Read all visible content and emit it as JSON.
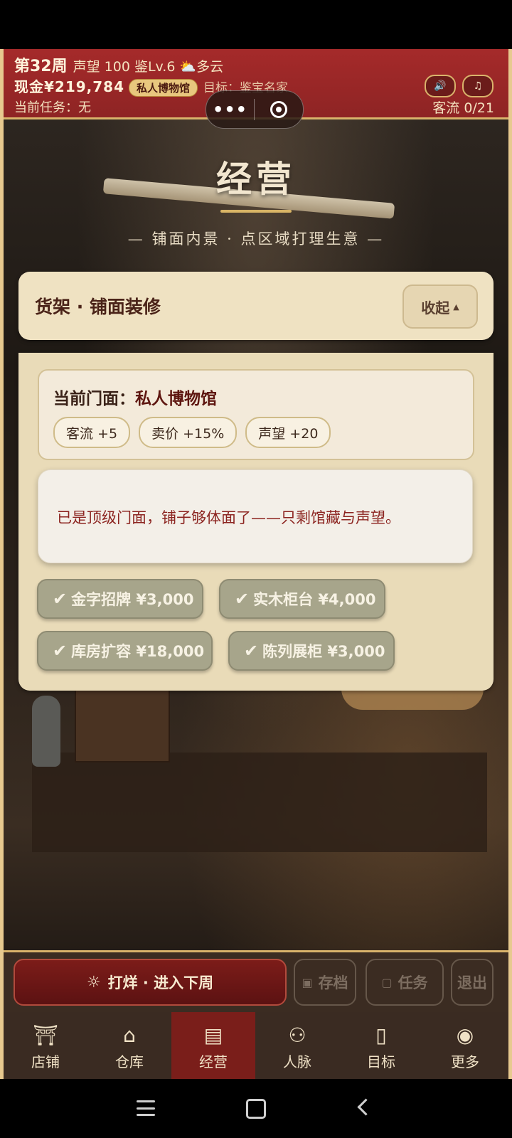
{
  "hud": {
    "week": "第32周",
    "reputation": "声望 100",
    "appraise_level": "鉴Lv.6",
    "weather": "⛅多云",
    "cash": "现金¥219,784",
    "shop_badge": "私人博物馆",
    "goal": "目标：鉴宝名家",
    "current_task": "当前任务：无",
    "traffic": "客流 0/21",
    "sound_icon": "speaker-icon",
    "music_icon": "music-note-icon"
  },
  "scene": {
    "title": "经营",
    "subtitle": "— 铺面内景 · 点区域打理生意 —"
  },
  "panel": {
    "title": "货架 · 铺面装修",
    "collapse_label": "收起",
    "collapse_arrow": "▲",
    "front_label": "当前门面：",
    "front_name": "私人博物馆",
    "chips": [
      "客流 +5",
      "卖价 +15%",
      "声望 +20"
    ],
    "note": "已是顶级门面，铺子够体面了——只剩馆藏与声望。",
    "upgrades": [
      {
        "label": "金字招牌 ¥3,000"
      },
      {
        "label": "实木柜台 ¥4,000"
      },
      {
        "label": "库房扩容 ¥18,000"
      },
      {
        "label": "陈列展柜 ¥3,000"
      }
    ]
  },
  "actions": {
    "next_week": "打烊 · 进入下周",
    "save": "存档",
    "tasks": "任务",
    "exit": "退出"
  },
  "tabs": [
    {
      "label": "店铺",
      "icon": "shop-icon"
    },
    {
      "label": "仓库",
      "icon": "warehouse-icon"
    },
    {
      "label": "经营",
      "icon": "ledger-icon"
    },
    {
      "label": "人脉",
      "icon": "people-icon"
    },
    {
      "label": "目标",
      "icon": "scroll-icon"
    },
    {
      "label": "更多",
      "icon": "more-icon"
    }
  ],
  "active_tab": "经营",
  "colors": {
    "hud_red": "#a52a2a",
    "gold": "#d9b36b",
    "active_tab": "#7a1e1a",
    "upgrade_done": "#a7a58b"
  }
}
